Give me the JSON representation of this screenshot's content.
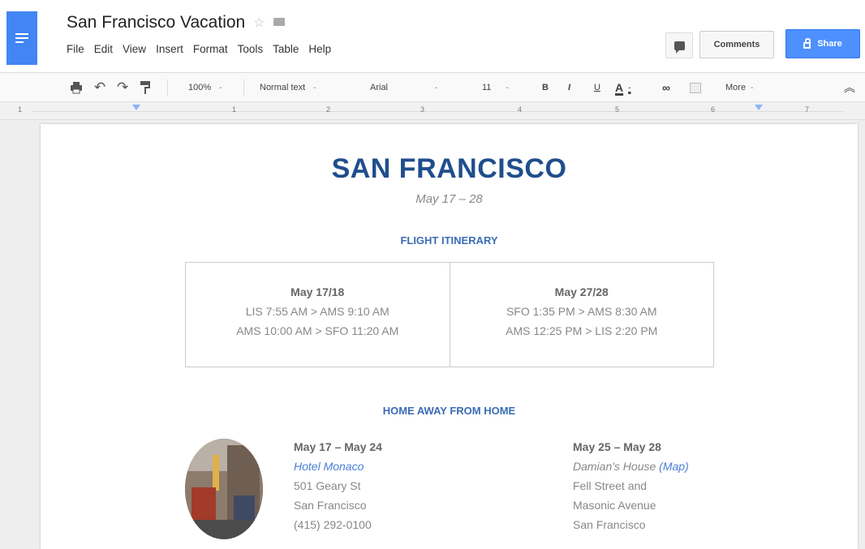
{
  "header": {
    "doc_title": "San Francisco Vacation",
    "menu": [
      "File",
      "Edit",
      "View",
      "Insert",
      "Format",
      "Tools",
      "Table",
      "Help"
    ],
    "comments_label": "Comments",
    "share_label": "Share"
  },
  "toolbar": {
    "zoom": "100%",
    "style": "Normal text",
    "font": "Arial",
    "font_size": "11",
    "bold": "B",
    "italic": "I",
    "underline": "U",
    "text_color": "A",
    "more": "More"
  },
  "ruler": {
    "numbers": [
      "1",
      "1",
      "2",
      "3",
      "4",
      "5",
      "6",
      "7"
    ]
  },
  "document": {
    "title": "SAN FRANCISCO",
    "dates": "May 17 – 28",
    "flight_heading": "FLIGHT ITINERARY",
    "flights": [
      {
        "date": "May 17/18",
        "legs": [
          "LIS 7:55 AM > AMS 9:10 AM",
          "AMS 10:00 AM > SFO 11:20 AM"
        ]
      },
      {
        "date": "May 27/28",
        "legs": [
          "SFO 1:35 PM > AMS 8:30 AM",
          "AMS 12:25 PM > LIS 2:20 PM"
        ]
      }
    ],
    "home_heading": "HOME AWAY FROM HOME",
    "stays": [
      {
        "dates": "May 17 – May 24",
        "name": "Hotel Monaco",
        "lines": [
          "501 Geary St",
          "San Francisco",
          "(415) 292-0100"
        ]
      },
      {
        "dates": "May 25 – May 28",
        "name": "Damian's House",
        "map_link": "(Map)",
        "lines": [
          "Fell Street and",
          "Masonic Avenue",
          "San Francisco"
        ]
      }
    ]
  },
  "colors": {
    "accent": "#4285f4",
    "share": "#4d90fe",
    "heading": "#1f4e8c",
    "link": "#4a7fd4"
  }
}
